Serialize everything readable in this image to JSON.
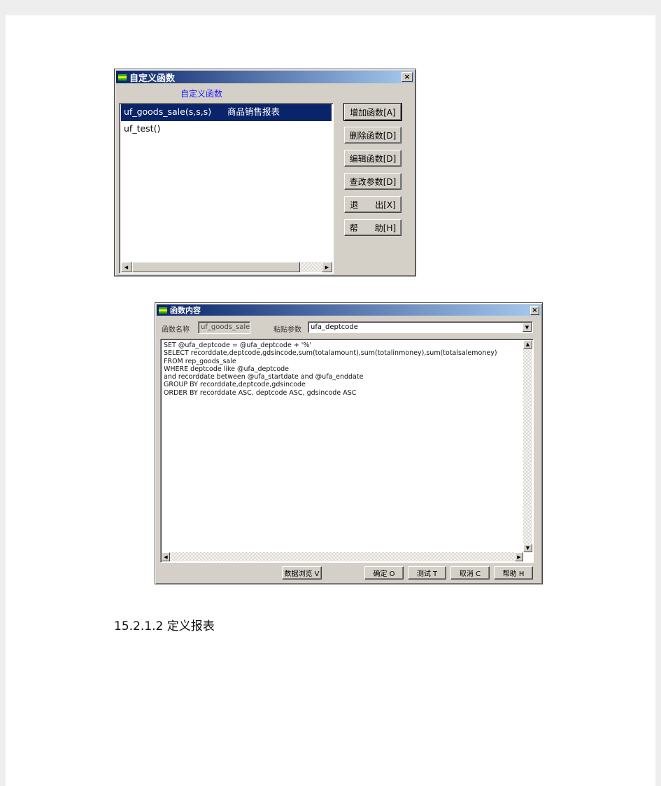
{
  "dialog1": {
    "title": "自定义函数",
    "subtitle": "自定义函数",
    "list": [
      {
        "name": "uf_goods_sale(s,s,s)",
        "desc": "商品销售报表",
        "selected": true
      },
      {
        "name": "uf_test()",
        "desc": "",
        "selected": false
      }
    ],
    "buttons": [
      "增加函数[A]",
      "删除函数[D]",
      "编辑函数[D]",
      "查改参数[D]",
      "退　　出[X]",
      "帮　　助[H]"
    ],
    "close": "×"
  },
  "dialog2": {
    "title": "函数内容",
    "name_label": "函数名称",
    "name_value": "uf_goods_sale",
    "param_label": "粘贴参数",
    "param_value": "ufa_deptcode",
    "code": [
      "SET @ufa_deptcode = @ufa_deptcode + '%'",
      "SELECT recorddate,deptcode,gdsincode,sum(totalamount),sum(totalinmoney),sum(totalsalemoney)",
      "FROM rep_goods_sale",
      "WHERE deptcode like @ufa_deptcode",
      "and recorddate between @ufa_startdate and @ufa_enddate",
      "GROUP BY recorddate,deptcode,gdsincode",
      "ORDER BY recorddate ASC, deptcode ASC, gdsincode ASC"
    ],
    "buttons": {
      "browse": "数据浏览 V",
      "ok": "确定 O",
      "test": "测试 T",
      "cancel": "取消 C",
      "help": "帮助 H"
    },
    "close": "×"
  },
  "heading": "15.2.1.2 定义报表"
}
